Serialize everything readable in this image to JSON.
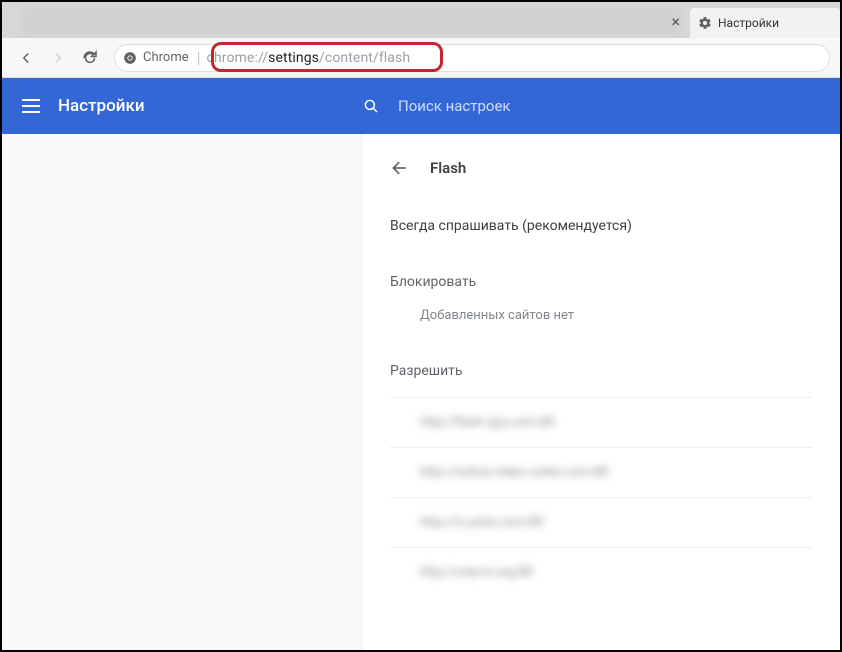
{
  "tabs": {
    "active_label": "Настройки"
  },
  "toolbar": {
    "chrome_label": "Chrome",
    "url_dim_prefix": "chrome://",
    "url_strong": "settings",
    "url_dim_suffix": "/content/flash"
  },
  "header": {
    "title": "Настройки",
    "search_placeholder": "Поиск настроек"
  },
  "content": {
    "page_title": "Flash",
    "default_behavior": "Всегда спрашивать (рекомендуется)",
    "block_section": "Блокировать",
    "block_empty": "Добавленных сайтов нет",
    "allow_section": "Разрешить",
    "allowed_sites": [
      "http://flash.igry.com:80",
      "http://online-video-cutter.com:80",
      "http://ru.pixiz.com:80",
      "http://only-tv.org:80"
    ]
  }
}
